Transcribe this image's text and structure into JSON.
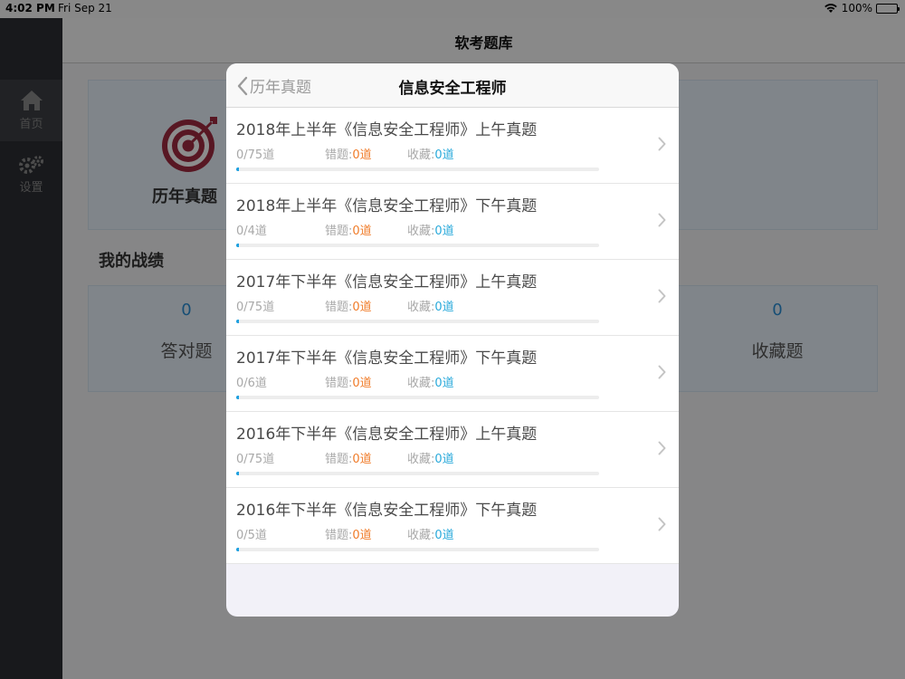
{
  "status_bar": {
    "time": "4:02 PM",
    "date": "Fri Sep 21",
    "battery": "100%",
    "icons": [
      "wifi-icon",
      "battery-icon"
    ]
  },
  "sidebar": {
    "items": [
      {
        "label": "首页",
        "icon": "home-icon",
        "active": true
      },
      {
        "label": "设置",
        "icon": "gear-icon",
        "active": false
      }
    ]
  },
  "main": {
    "title": "软考题库",
    "history_card_label": "历年真题",
    "section_title": "我的战绩",
    "stats": [
      {
        "value": "0",
        "label": "答对题"
      },
      {
        "value": "0",
        "label": "收藏题"
      }
    ]
  },
  "modal": {
    "back_label": "历年真题",
    "title": "信息安全工程师",
    "wrong_label": "错题:",
    "fav_label": "收藏:",
    "items": [
      {
        "title": "2018年上半年《信息安全工程师》上午真题",
        "progress": "0/75道",
        "wrong": "0道",
        "fav": "0道",
        "progress_fraction": 0
      },
      {
        "title": "2018年上半年《信息安全工程师》下午真题",
        "progress": "0/4道",
        "wrong": "0道",
        "fav": "0道",
        "progress_fraction": 0
      },
      {
        "title": "2017年下半年《信息安全工程师》上午真题",
        "progress": "0/75道",
        "wrong": "0道",
        "fav": "0道",
        "progress_fraction": 0
      },
      {
        "title": "2017年下半年《信息安全工程师》下午真题",
        "progress": "0/6道",
        "wrong": "0道",
        "fav": "0道",
        "progress_fraction": 0
      },
      {
        "title": "2016年下半年《信息安全工程师》上午真题",
        "progress": "0/75道",
        "wrong": "0道",
        "fav": "0道",
        "progress_fraction": 0
      },
      {
        "title": "2016年下半年《信息安全工程师》下午真题",
        "progress": "0/5道",
        "wrong": "0道",
        "fav": "0道",
        "progress_fraction": 0
      }
    ]
  },
  "colors": {
    "accent_blue": "#1ea0e0",
    "wrong_orange": "#f07c2a",
    "fav_blue": "#2aaadb",
    "sidebar_bg": "#2d2f33"
  }
}
